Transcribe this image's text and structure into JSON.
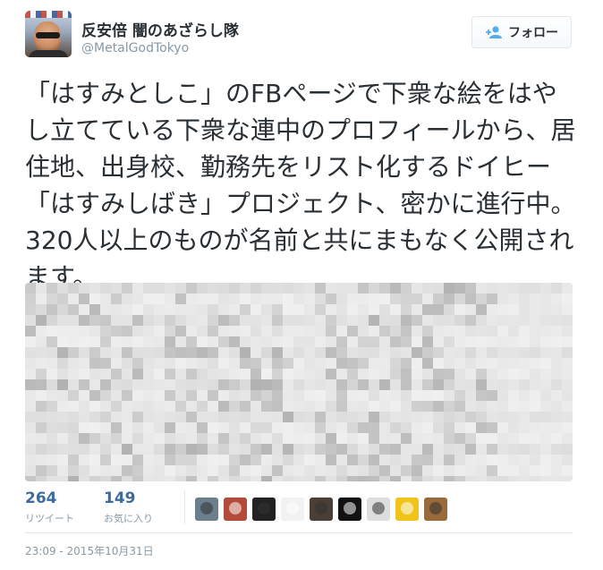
{
  "user": {
    "display_name": "反安倍 闇のあざらし隊",
    "handle": "@MetalGodTokyo"
  },
  "follow_button": {
    "label": "フォロー",
    "icon": "add-user-icon"
  },
  "tweet": {
    "text": "「はすみとしこ」のFBページで下衆な絵をはやし立てている下衆な連中のプロフィールから、居住地、出身校、勤務先をリスト化するドイヒー「はすみしばき」プロジェクト、密かに進行中。320人以上のものが名前と共にまもなく公開されます。"
  },
  "stats": {
    "retweets": {
      "count": "264",
      "label": "リツイート"
    },
    "likes": {
      "count": "149",
      "label": "お気に入り"
    }
  },
  "likers": [
    {
      "name": "liker-avatar-1",
      "color": "#6b7f8c"
    },
    {
      "name": "liker-avatar-2",
      "color": "#b34a3a"
    },
    {
      "name": "liker-avatar-3",
      "color": "#222222"
    },
    {
      "name": "liker-avatar-4",
      "color": "#f2f2f2"
    },
    {
      "name": "liker-avatar-5",
      "color": "#4a3f36"
    },
    {
      "name": "liker-avatar-6",
      "color": "#111111"
    },
    {
      "name": "liker-avatar-7",
      "color": "#dedede"
    },
    {
      "name": "liker-avatar-8",
      "color": "#f0c419"
    },
    {
      "name": "liker-avatar-9",
      "color": "#9a6a3a"
    }
  ],
  "timestamp": "23:09 - 2015年10月31日",
  "colors": {
    "link": "#3b6a9b",
    "muted": "#8899a6",
    "text": "#292f33",
    "border": "#e1e8ed"
  }
}
